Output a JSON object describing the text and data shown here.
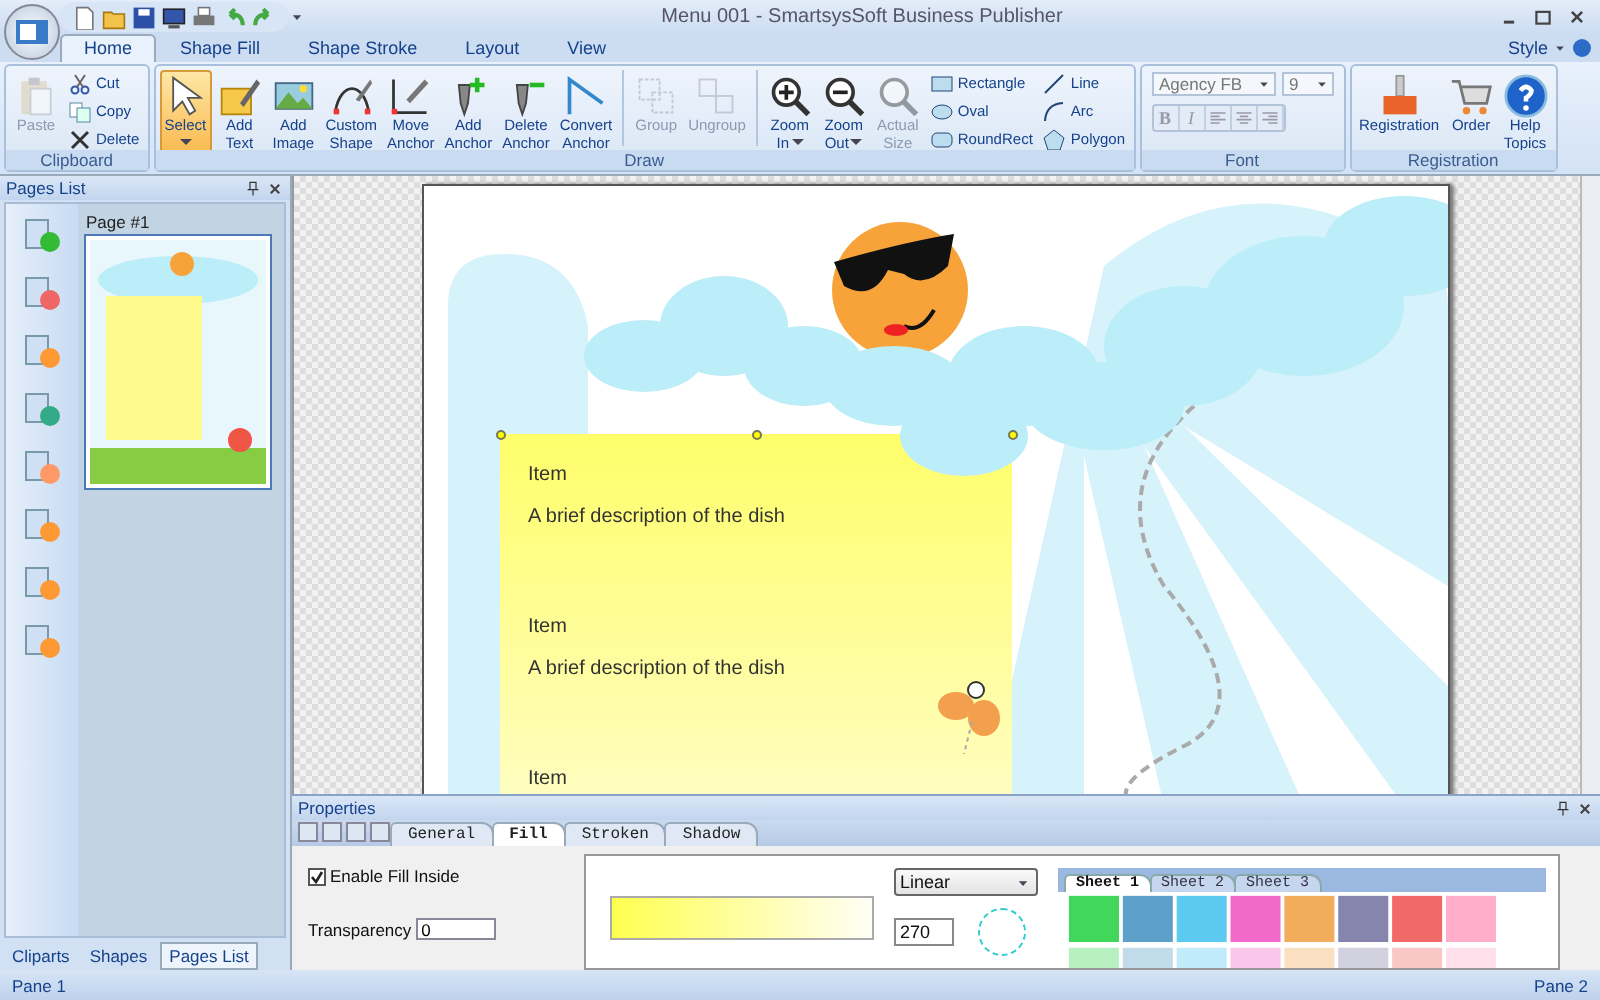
{
  "window": {
    "title": "Menu 001 - SmartsysSoft Business Publisher"
  },
  "ribbon_tabs": [
    {
      "label": "Home",
      "selected": true
    },
    {
      "label": "Shape Fill",
      "selected": false
    },
    {
      "label": "Shape Stroke",
      "selected": false
    },
    {
      "label": "Layout",
      "selected": false
    },
    {
      "label": "View",
      "selected": false
    }
  ],
  "style_menu": {
    "label": "Style"
  },
  "ribbon_groups": [
    {
      "title": "Clipboard",
      "items": [
        {
          "kind": "large",
          "label": "Paste",
          "disabled": true,
          "selected": false,
          "dropdown": false
        },
        {
          "kind": "small",
          "label": "Cut",
          "disabled": false
        },
        {
          "kind": "small",
          "label": "Copy",
          "disabled": false
        },
        {
          "kind": "small",
          "label": "Delete",
          "disabled": false
        }
      ]
    },
    {
      "title": "Draw",
      "items": [
        {
          "kind": "large",
          "label": "Select",
          "disabled": false,
          "selected": true,
          "dropdown": true
        },
        {
          "kind": "large",
          "label": "Add Text",
          "disabled": false,
          "selected": false,
          "dropdown": false
        },
        {
          "kind": "large",
          "label": "Add Image",
          "disabled": false,
          "selected": false,
          "dropdown": false
        },
        {
          "kind": "large",
          "label": "Custom Shape",
          "disabled": false,
          "selected": false,
          "dropdown": false
        },
        {
          "kind": "large",
          "label": "Move Anchor",
          "disabled": false,
          "selected": false,
          "dropdown": false
        },
        {
          "kind": "large",
          "label": "Add Anchor",
          "disabled": false,
          "selected": false,
          "dropdown": false
        },
        {
          "kind": "large",
          "label": "Delete Anchor",
          "disabled": false,
          "selected": false,
          "dropdown": false
        },
        {
          "kind": "large",
          "label": "Convert Anchor",
          "disabled": false,
          "selected": false,
          "dropdown": false
        },
        {
          "kind": "separator"
        },
        {
          "kind": "large",
          "label": "Group",
          "disabled": true,
          "selected": false,
          "dropdown": false
        },
        {
          "kind": "large",
          "label": "Ungroup",
          "disabled": true,
          "selected": false,
          "dropdown": false
        },
        {
          "kind": "separator"
        },
        {
          "kind": "large",
          "label": "Zoom In",
          "disabled": false,
          "selected": false,
          "dropdown": true
        },
        {
          "kind": "large",
          "label": "Zoom Out",
          "disabled": false,
          "selected": false,
          "dropdown": true
        },
        {
          "kind": "large",
          "label": "Actual Size",
          "disabled": true,
          "selected": false,
          "dropdown": false
        },
        {
          "kind": "small",
          "label": "Rectangle",
          "disabled": false
        },
        {
          "kind": "small",
          "label": "Oval",
          "disabled": false
        },
        {
          "kind": "small",
          "label": "RoundRect",
          "disabled": false
        },
        {
          "kind": "small",
          "label": "Line",
          "disabled": false
        },
        {
          "kind": "small",
          "label": "Arc",
          "disabled": false
        },
        {
          "kind": "small",
          "label": "Polygon",
          "disabled": false
        }
      ]
    },
    {
      "title": "Font",
      "items": [
        {
          "kind": "font",
          "font": "Agency FB",
          "size": "9",
          "format": [
            {
              "kind": "text",
              "label": "B"
            },
            {
              "kind": "text",
              "label": "I"
            },
            {
              "kind": "icon"
            },
            {
              "kind": "icon"
            },
            {
              "kind": "icon"
            }
          ]
        }
      ]
    },
    {
      "title": "Registration",
      "items": [
        {
          "kind": "large",
          "label": "Registration",
          "disabled": false,
          "selected": false,
          "dropdown": false
        },
        {
          "kind": "large",
          "label": "Order",
          "disabled": false,
          "selected": false,
          "dropdown": false
        },
        {
          "kind": "large",
          "label": "Help Topics",
          "disabled": false,
          "selected": false,
          "dropdown": false
        }
      ]
    }
  ],
  "pages_panel": {
    "title": "Pages List",
    "pages": [
      {
        "label": "Page #1",
        "selected": true
      }
    ],
    "bottom_tabs": [
      {
        "label": "Cliparts",
        "selected": false
      },
      {
        "label": "Shapes",
        "selected": false
      },
      {
        "label": "Pages List",
        "selected": true
      }
    ]
  },
  "document": {
    "menu_items": [
      {
        "title": "Item",
        "description": "A brief description of the dish"
      },
      {
        "title": "Item",
        "description": "A brief description of the dish"
      },
      {
        "title": "Item"
      }
    ]
  },
  "properties": {
    "title": "Properties",
    "tabs": [
      {
        "label": "General",
        "selected": false
      },
      {
        "label": "Fill",
        "selected": true
      },
      {
        "label": "Stroken",
        "selected": false
      },
      {
        "label": "Shadow",
        "selected": false
      }
    ],
    "enable_fill": {
      "label": "Enable Fill Inside",
      "checked": true
    },
    "transparency": {
      "label": "Transparency",
      "value": "0"
    },
    "gradient_type": "Linear",
    "angle": "270",
    "sheet_tabs": [
      {
        "label": "Sheet 1",
        "selected": true
      },
      {
        "label": "Sheet 2",
        "selected": false
      },
      {
        "label": "Sheet 3",
        "selected": false
      }
    ]
  },
  "status_bar": {
    "left": "Pane 1",
    "right": "Pane 2"
  }
}
